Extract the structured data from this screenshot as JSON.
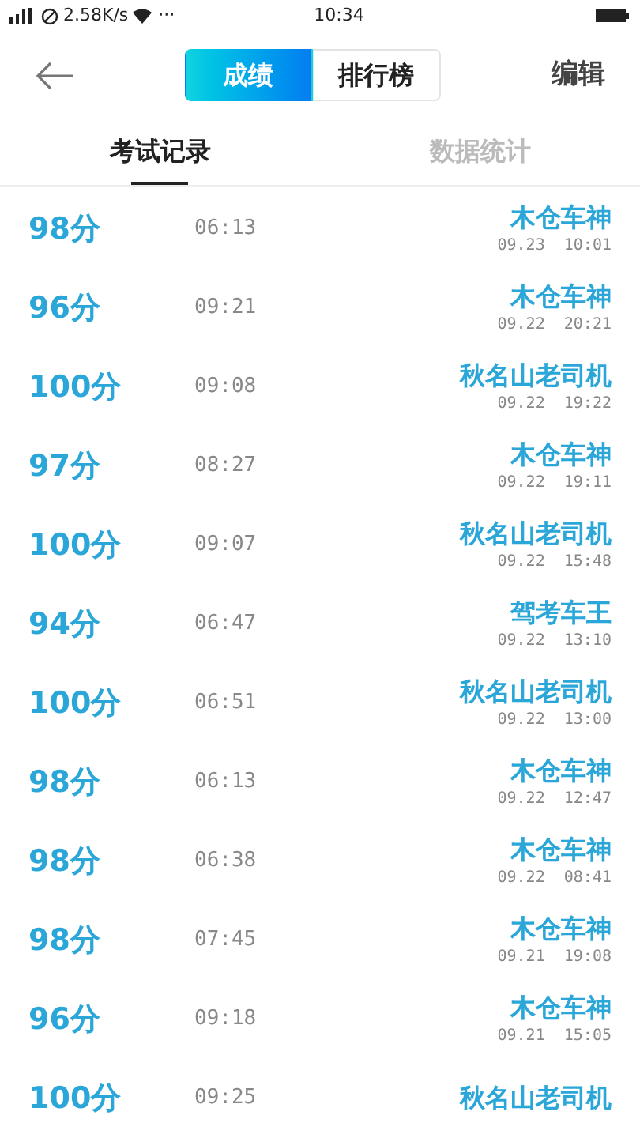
{
  "status_bar": {
    "network_speed": "2.58K/s",
    "more": "···",
    "time": "10:34"
  },
  "nav": {
    "segments": [
      {
        "label": "成绩",
        "selected": true
      },
      {
        "label": "排行榜",
        "selected": false
      }
    ],
    "edit": "编辑"
  },
  "tabs": [
    {
      "label": "考试记录",
      "selected": true
    },
    {
      "label": "数据统计",
      "selected": false
    }
  ],
  "records": [
    {
      "score": "98分",
      "duration": "06:13",
      "title": "木仓车神",
      "date": "09.23  10:01"
    },
    {
      "score": "96分",
      "duration": "09:21",
      "title": "木仓车神",
      "date": "09.22  20:21"
    },
    {
      "score": "100分",
      "duration": "09:08",
      "title": "秋名山老司机",
      "date": "09.22  19:22"
    },
    {
      "score": "97分",
      "duration": "08:27",
      "title": "木仓车神",
      "date": "09.22  19:11"
    },
    {
      "score": "100分",
      "duration": "09:07",
      "title": "秋名山老司机",
      "date": "09.22  15:48"
    },
    {
      "score": "94分",
      "duration": "06:47",
      "title": "驾考车王",
      "date": "09.22  13:10"
    },
    {
      "score": "100分",
      "duration": "06:51",
      "title": "秋名山老司机",
      "date": "09.22  13:00"
    },
    {
      "score": "98分",
      "duration": "06:13",
      "title": "木仓车神",
      "date": "09.22  12:47"
    },
    {
      "score": "98分",
      "duration": "06:38",
      "title": "木仓车神",
      "date": "09.22  08:41"
    },
    {
      "score": "98分",
      "duration": "07:45",
      "title": "木仓车神",
      "date": "09.21  19:08"
    },
    {
      "score": "96分",
      "duration": "09:18",
      "title": "木仓车神",
      "date": "09.21  15:05"
    },
    {
      "score": "100分",
      "duration": "09:25",
      "title": "秋名山老司机"
    }
  ]
}
